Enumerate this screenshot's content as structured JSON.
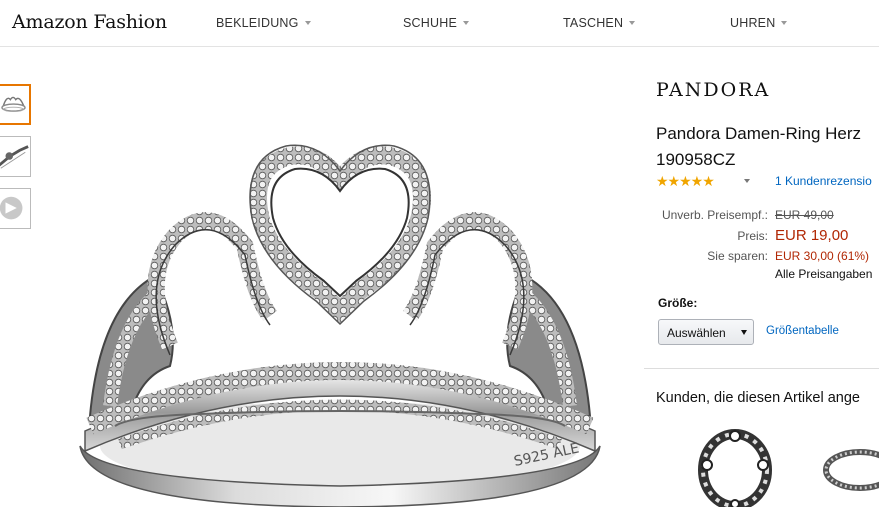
{
  "header": {
    "logo": "Amazon Fashion",
    "nav": [
      {
        "label": "BEKLEIDUNG"
      },
      {
        "label": "SCHUHE"
      },
      {
        "label": "TASCHEN"
      },
      {
        "label": "UHREN"
      }
    ]
  },
  "thumbnails": [
    {
      "icon": "crown-ring-thumbnail",
      "selected": true
    },
    {
      "icon": "ring-side-view-thumbnail",
      "selected": false
    },
    {
      "icon": "video-play-thumbnail",
      "selected": false
    }
  ],
  "main_image": {
    "icon": "pandora-princess-crown-ring",
    "engraving": "S925 ALE"
  },
  "product": {
    "brand": "PANDORA",
    "title_line1": "Pandora Damen-Ring Herz",
    "title_line2": "190958CZ",
    "rating": {
      "stars": "★★★★★",
      "value": 5,
      "max": 5,
      "review_link": "1 Kundenrezensio"
    },
    "prices": {
      "list_label": "Unverb. Preisempf.:",
      "list_value": "EUR 49,00",
      "price_label": "Preis:",
      "price_value": "EUR 19,00",
      "save_label": "Sie sparen:",
      "save_value": "EUR 30,00 (61%)",
      "all_prices_note": "Alle Preisangaben"
    },
    "size": {
      "label": "Größe:",
      "selected": "Auswählen",
      "chart_link": "Größentabelle"
    }
  },
  "recommendations": {
    "heading": "Kunden, die diesen Artikel ange",
    "items": [
      {
        "icon": "eye-charm-ring-thumbnail"
      },
      {
        "icon": "beaded-ring-thumbnail"
      }
    ]
  },
  "colors": {
    "link": "#0066c0",
    "price": "#b12704",
    "star": "#f0a500",
    "accent": "#e77600"
  }
}
